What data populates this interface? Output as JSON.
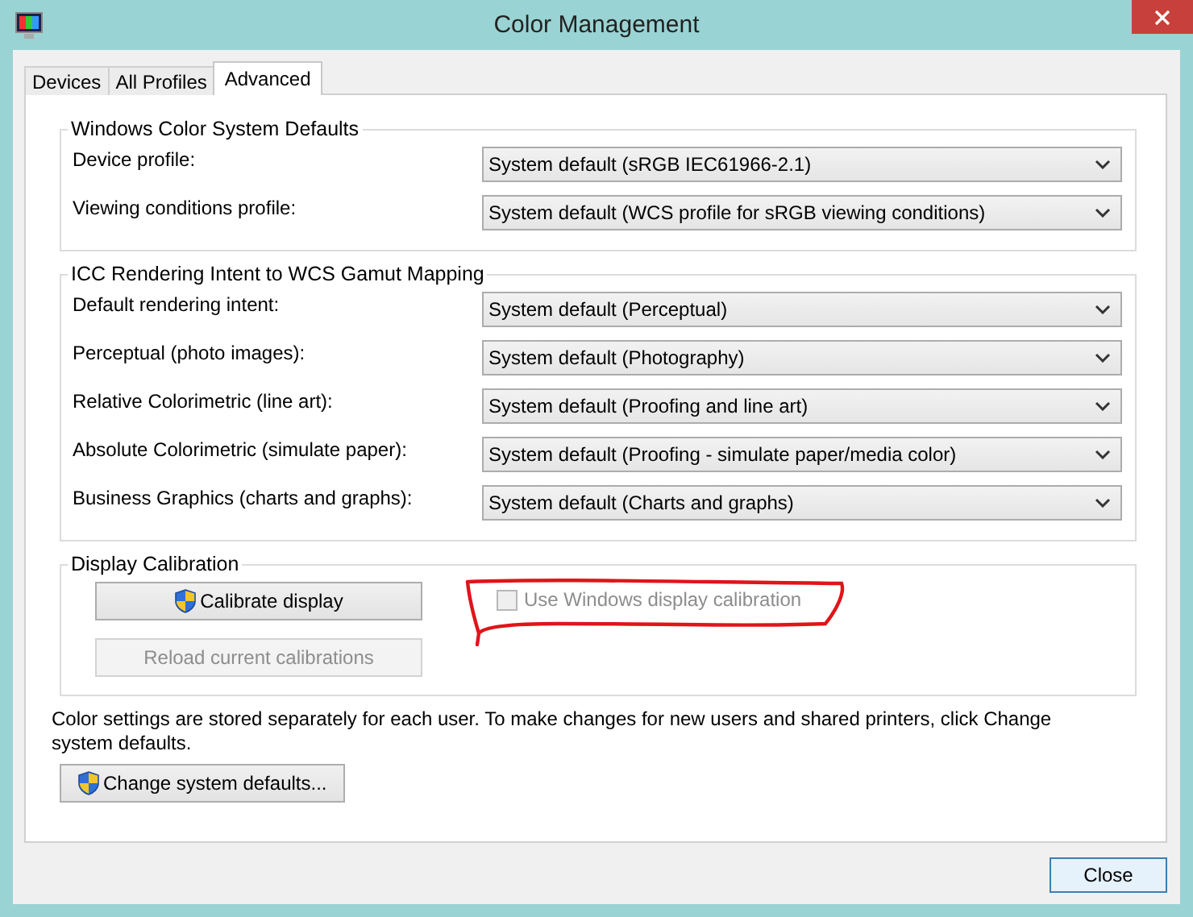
{
  "window": {
    "title": "Color Management"
  },
  "tabs": [
    {
      "label": "Devices",
      "selected": false
    },
    {
      "label": "All Profiles",
      "selected": false
    },
    {
      "label": "Advanced",
      "selected": true
    }
  ],
  "groups": [
    {
      "title": "Windows Color System Defaults",
      "rows": [
        {
          "label": "Device profile:",
          "value": "System default (sRGB IEC61966-2.1)"
        },
        {
          "label": "Viewing conditions profile:",
          "value": "System default (WCS profile for sRGB viewing conditions)"
        }
      ]
    },
    {
      "title": "ICC Rendering Intent to WCS Gamut Mapping",
      "rows": [
        {
          "label": "Default rendering intent:",
          "value": "System default (Perceptual)"
        },
        {
          "label": "Perceptual (photo images):",
          "value": "System default (Photography)"
        },
        {
          "label": "Relative Colorimetric (line art):",
          "value": "System default (Proofing and line art)"
        },
        {
          "label": "Absolute Colorimetric (simulate paper):",
          "value": "System default (Proofing - simulate paper/media color)"
        },
        {
          "label": "Business Graphics (charts and graphs):",
          "value": "System default (Charts and graphs)"
        }
      ]
    }
  ],
  "calibration": {
    "title": "Display Calibration",
    "buttons": [
      {
        "label": "Calibrate display",
        "shield": true,
        "disabled": false
      },
      {
        "label": "Reload current calibrations",
        "shield": false,
        "disabled": true
      }
    ],
    "checkbox": {
      "label": "Use Windows display calibration",
      "checked": false,
      "disabled": true
    }
  },
  "note": "Color settings are stored separately for each user. To make changes for new users and shared printers, click Change system defaults.",
  "change_button": {
    "label": "Change system defaults...",
    "shield": true
  },
  "close_button": {
    "label": "Close"
  }
}
